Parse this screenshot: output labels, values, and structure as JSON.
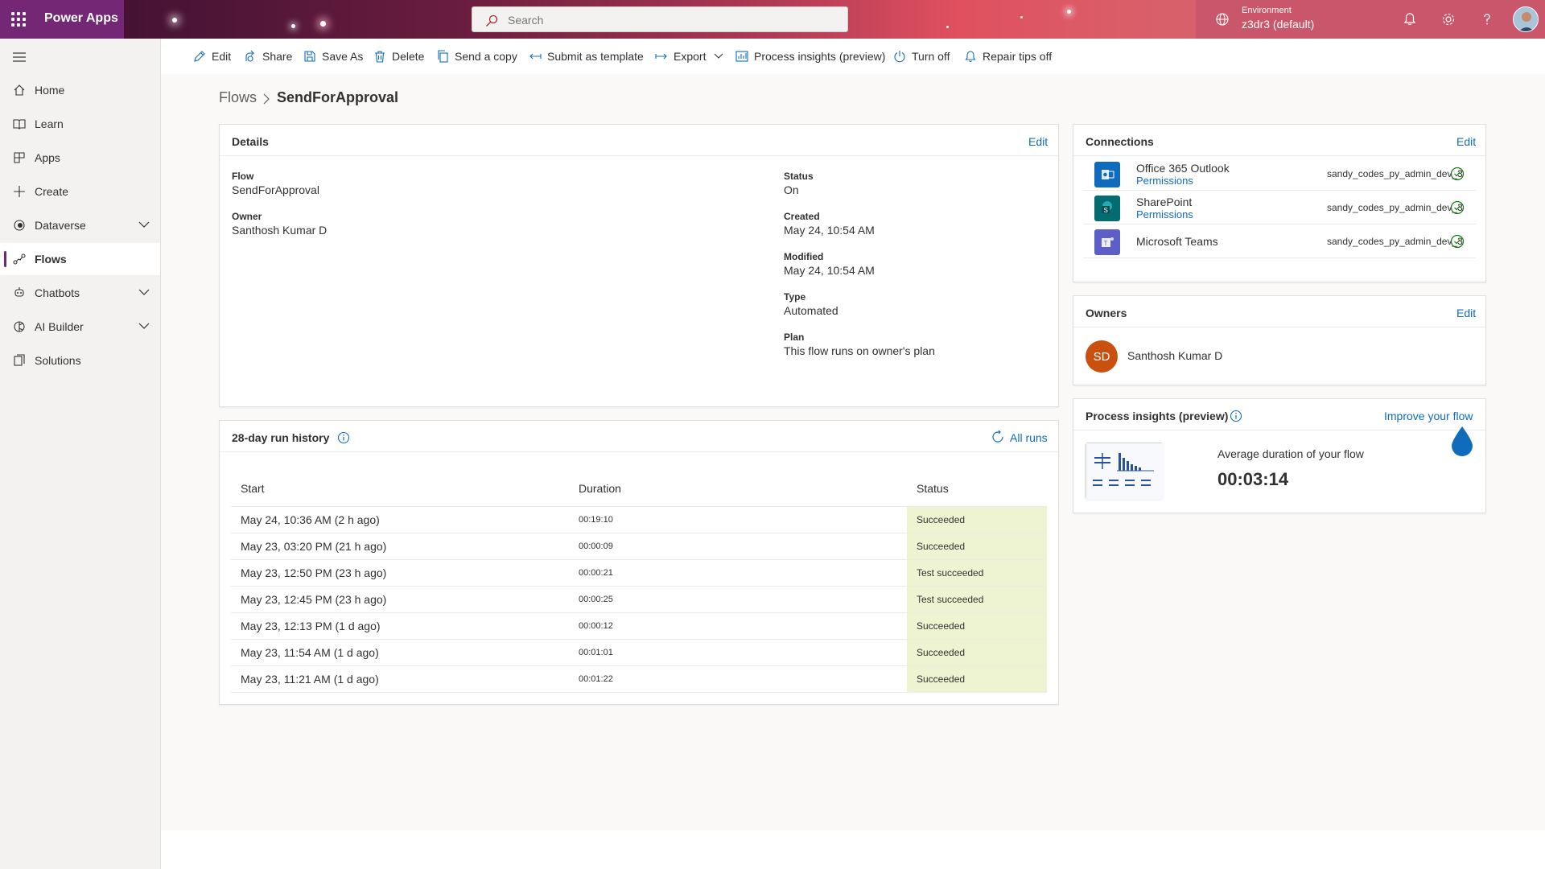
{
  "app": {
    "name": "Power Apps"
  },
  "search": {
    "placeholder": "Search"
  },
  "environment": {
    "label": "Environment",
    "value": "z3dr3 (default)"
  },
  "topbar_icons": [
    "bell-icon",
    "gear-icon",
    "help-icon"
  ],
  "sidebar": {
    "items": [
      {
        "label": "Home",
        "icon": "home-icon"
      },
      {
        "label": "Learn",
        "icon": "book-icon"
      },
      {
        "label": "Apps",
        "icon": "apps-icon"
      },
      {
        "label": "Create",
        "icon": "plus-icon"
      },
      {
        "label": "Dataverse",
        "icon": "dataverse-icon",
        "expandable": true
      },
      {
        "label": "Flows",
        "icon": "flows-icon",
        "active": true
      },
      {
        "label": "Chatbots",
        "icon": "chatbot-icon",
        "expandable": true
      },
      {
        "label": "AI Builder",
        "icon": "ai-builder-icon",
        "expandable": true
      },
      {
        "label": "Solutions",
        "icon": "solutions-icon"
      }
    ]
  },
  "commands": [
    {
      "label": "Edit",
      "icon": "pencil-icon"
    },
    {
      "label": "Share",
      "icon": "share-icon"
    },
    {
      "label": "Save As",
      "icon": "save-as-icon"
    },
    {
      "label": "Delete",
      "icon": "trash-icon"
    },
    {
      "label": "Send a copy",
      "icon": "copy-icon"
    },
    {
      "label": "Submit as template",
      "icon": "submit-icon"
    },
    {
      "label": "Export",
      "icon": "export-icon"
    },
    {
      "label": "Process insights (preview)",
      "icon": "insights-icon"
    },
    {
      "label": "Turn off",
      "icon": "power-icon"
    },
    {
      "label": "Repair tips off",
      "icon": "bell-icon"
    }
  ],
  "breadcrumb": {
    "root": "Flows",
    "current": "SendForApproval"
  },
  "details": {
    "title": "Details",
    "edit": "Edit",
    "flow_label": "Flow",
    "flow_value": "SendForApproval",
    "owner_label": "Owner",
    "owner_value": "Santhosh Kumar D",
    "status_label": "Status",
    "status_value": "On",
    "created_label": "Created",
    "created_value": "May 24, 10:54 AM",
    "modified_label": "Modified",
    "modified_value": "May 24, 10:54 AM",
    "type_label": "Type",
    "type_value": "Automated",
    "plan_label": "Plan",
    "plan_value": "This flow runs on owner's plan"
  },
  "connections": {
    "title": "Connections",
    "edit": "Edit",
    "items": [
      {
        "name": "Office 365 Outlook",
        "permissions": "Permissions",
        "account": "sandy_codes_py_admin_dev_3",
        "color": "#0f6cbd",
        "icon": "outlook-icon"
      },
      {
        "name": "SharePoint",
        "permissions": "Permissions",
        "account": "sandy_codes_py_admin_dev_3",
        "color": "#036c70",
        "icon": "sharepoint-icon"
      },
      {
        "name": "Microsoft Teams",
        "permissions": "",
        "account": "sandy_codes_py_admin_dev_3",
        "color": "#5b5fc7",
        "icon": "teams-icon"
      }
    ]
  },
  "owners": {
    "title": "Owners",
    "edit": "Edit",
    "initials": "SD",
    "name": "Santhosh Kumar D",
    "avatar_color": "#ca5010"
  },
  "process_insights": {
    "title": "Process insights (preview)",
    "link": "Improve your flow",
    "avg_label": "Average duration of your flow",
    "avg_value": "00:03:14"
  },
  "run_history": {
    "title": "28-day run history",
    "all_runs": "All runs",
    "columns": [
      "Start",
      "Duration",
      "Status"
    ],
    "rows": [
      {
        "start": "May 24, 10:36 AM (2 h ago)",
        "duration": "00:19:10",
        "status": "Succeeded"
      },
      {
        "start": "May 23, 03:20 PM (21 h ago)",
        "duration": "00:00:09",
        "status": "Succeeded"
      },
      {
        "start": "May 23, 12:50 PM (23 h ago)",
        "duration": "00:00:21",
        "status": "Test succeeded"
      },
      {
        "start": "May 23, 12:45 PM (23 h ago)",
        "duration": "00:00:25",
        "status": "Test succeeded"
      },
      {
        "start": "May 23, 12:13 PM (1 d ago)",
        "duration": "00:00:12",
        "status": "Succeeded"
      },
      {
        "start": "May 23, 11:54 AM (1 d ago)",
        "duration": "00:01:01",
        "status": "Succeeded"
      },
      {
        "start": "May 23, 11:21 AM (1 d ago)",
        "duration": "00:01:22",
        "status": "Succeeded"
      }
    ]
  }
}
